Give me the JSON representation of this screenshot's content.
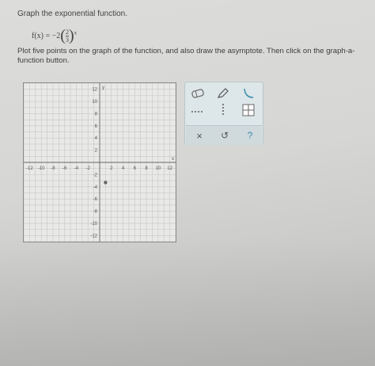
{
  "question": {
    "instruction": "Graph the exponential function.",
    "function_lhs": "f(x) = −2",
    "frac_num": "2",
    "frac_den": "3",
    "exponent": "x",
    "prompt": "Plot five points on the graph of the function, and also draw the asymptote. Then click on the graph-a-function button."
  },
  "graph": {
    "x_range": [
      -13,
      13
    ],
    "y_range": [
      -13,
      13
    ],
    "grid_step": 1,
    "x_ticks": [
      "-12",
      "-10",
      "-8",
      "-6",
      "-4",
      "-2",
      "2",
      "4",
      "6",
      "8",
      "10",
      "12"
    ],
    "y_ticks": [
      "12",
      "10",
      "8",
      "6",
      "4",
      "2",
      "-2",
      "-4",
      "-6",
      "-8",
      "-10",
      "-12"
    ],
    "x_axis_label": "x",
    "y_axis_label": "y",
    "plotted_points": [
      [
        1,
        -3.3
      ]
    ]
  },
  "toolbar": {
    "eraser_icon": "eraser-icon",
    "pencil_icon": "pencil-icon",
    "curve_icon": "curve-icon",
    "dashed_line_icon": "dashed-line-icon",
    "vertical_line_icon": "vertical-line-icon",
    "function_icon": "function-grid-icon",
    "close_label": "×",
    "undo_label": "↺",
    "help_label": "?"
  },
  "colors": {
    "accent": "#3a8fb0"
  }
}
